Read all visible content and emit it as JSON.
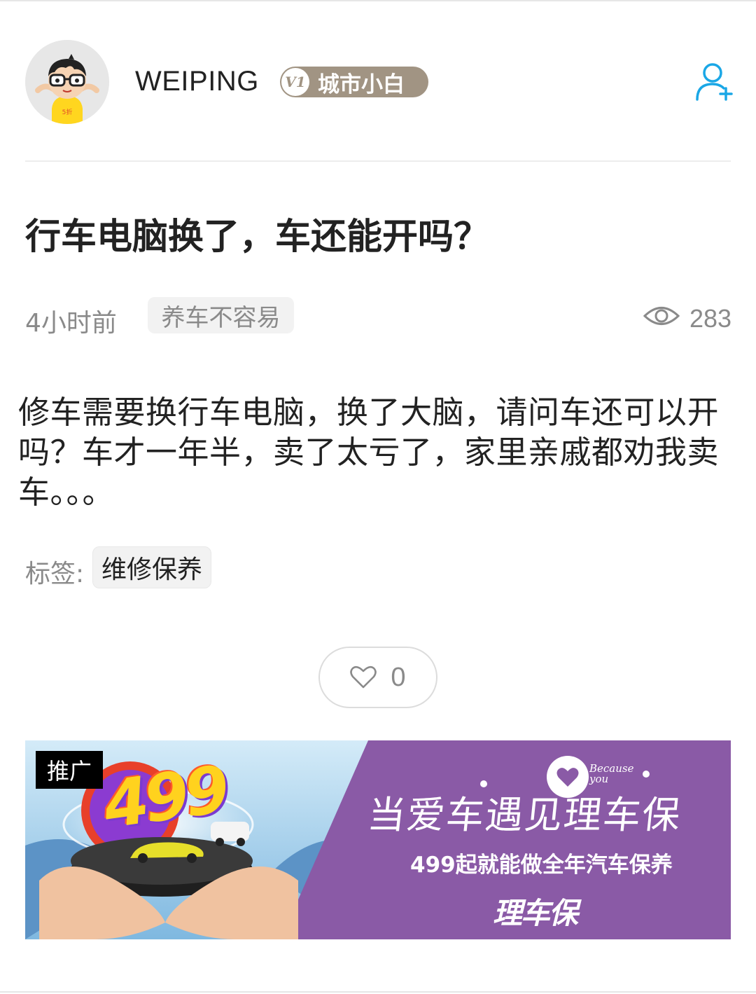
{
  "author": {
    "name": "WEIPING",
    "level_icon": "V1",
    "level_label": "城市小白",
    "follow_icon": "add-user-icon"
  },
  "post": {
    "title": "行车电脑换了，车还能开吗？",
    "time": "4小时前",
    "category": "养车不容易",
    "views": "283",
    "body": "修车需要换行车电脑，换了大脑，请问车还可以开吗？车才一年半，卖了太亏了，家里亲戚都劝我卖车。。。",
    "tags_label": "标签:",
    "tags": [
      "维修保养"
    ],
    "likes": "0"
  },
  "ad": {
    "badge": "推广",
    "number": "499",
    "headline": "当爱车遇见理车保",
    "subline": "499起就能做全年汽车保养",
    "brand": "理车保",
    "because_line1": "Because",
    "because_line2": "you"
  },
  "colors": {
    "accent": "#1aa7e6",
    "badge_bg": "#a19483",
    "ad_purple": "#8a5aa6",
    "ad_blue": "#a9d3ee"
  }
}
